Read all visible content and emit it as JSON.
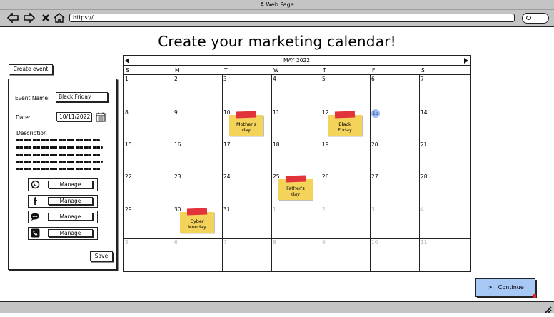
{
  "window": {
    "title": "A Web Page"
  },
  "browser": {
    "url": "https://",
    "icons": [
      "arrow-left-icon",
      "arrow-right-icon",
      "close-icon",
      "home-icon",
      "search-icon"
    ]
  },
  "page": {
    "title": "Create your marketing calendar!"
  },
  "sidebar": {
    "create_event_label": "Create event",
    "event_name_label": "Event Name:",
    "event_name_value": "Black Friday",
    "date_label": "Date:",
    "date_value": "10/11/2022",
    "description_label": "Description",
    "socials": [
      {
        "icon": "whatsapp-icon",
        "label": "Manage"
      },
      {
        "icon": "facebook-icon",
        "label": "Manage"
      },
      {
        "icon": "chat-bubble-icon",
        "label": "Manage"
      },
      {
        "icon": "phone-icon",
        "label": "Manage"
      }
    ],
    "save_label": "Save"
  },
  "calendar": {
    "month_label": "MAY 2022",
    "weekdays": [
      "S",
      "M",
      "T",
      "W",
      "T",
      "F",
      "S"
    ],
    "weeks": [
      [
        "1",
        "2",
        "3",
        "4",
        "5",
        "6",
        "7"
      ],
      [
        "8",
        "9",
        "10",
        "11",
        "12",
        "13",
        "14"
      ],
      [
        "15",
        "16",
        "17",
        "18",
        "19",
        "20",
        "21"
      ],
      [
        "22",
        "23",
        "24",
        "25",
        "26",
        "27",
        "28"
      ],
      [
        "29",
        "30",
        "31",
        "1",
        "2",
        "3",
        "4"
      ],
      [
        "5",
        "6",
        "7",
        "8",
        "9",
        "10",
        "11"
      ]
    ],
    "today": "13",
    "events": [
      {
        "label": "Mother's day",
        "date": "10"
      },
      {
        "label": "Black Friday",
        "date": "12"
      },
      {
        "label": "Father's day",
        "date": "25"
      },
      {
        "label": "Cyber Monday",
        "date": "30"
      }
    ]
  },
  "footer": {
    "continue_label": "Continue"
  },
  "colors": {
    "sticky": "#f4d35b",
    "tape": "#e2323a",
    "today": "#9dbdf0",
    "continue": "#a7c7f4",
    "chrome": "#c4c4c4"
  }
}
